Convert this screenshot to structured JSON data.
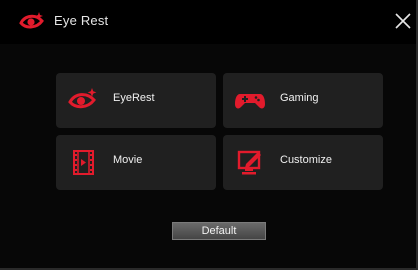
{
  "window": {
    "title": "Eye Rest",
    "close_icon": "close-icon",
    "logo_icon": "eye-rest-logo-icon"
  },
  "modes": [
    {
      "label": "EyeRest",
      "icon": "eye-rest-icon"
    },
    {
      "label": "Gaming",
      "icon": "gamepad-icon"
    },
    {
      "label": "Movie",
      "icon": "film-strip-icon"
    },
    {
      "label": "Customize",
      "icon": "edit-monitor-icon"
    }
  ],
  "default_button": {
    "label": "Default"
  },
  "colors": {
    "accent": "#e21b2c",
    "background": "#070707",
    "tile": "#202020",
    "text": "#f0f0f0"
  }
}
